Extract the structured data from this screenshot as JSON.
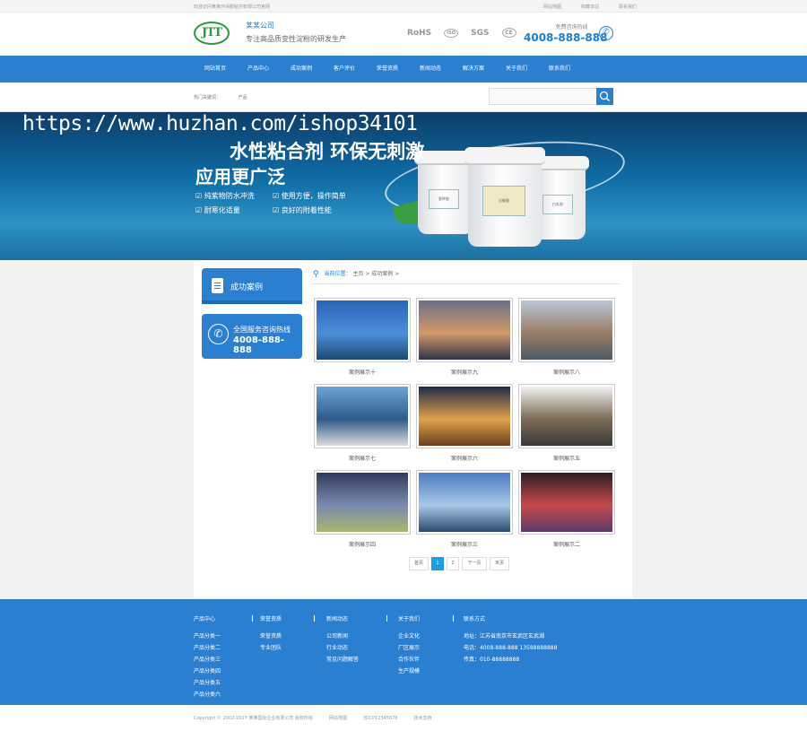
{
  "topbar": {
    "welcome": "欢迎访问某某环保胶粘剂有限公司官网",
    "links": [
      "网站地图",
      "收藏本站",
      "联系我们"
    ]
  },
  "header": {
    "logo_text": "JTT",
    "company_name": "某某公司",
    "slogan": "专注高品质变性淀粉的研发生产",
    "certs": [
      "RoHS",
      "ISO",
      "SGS",
      "CE"
    ],
    "hotline_label": "免费咨询热线",
    "hotline_number": "4008-888-888"
  },
  "nav": {
    "items": [
      "网站首页",
      "产品中心",
      "成功案例",
      "客户评价",
      "荣誉资质",
      "新闻动态",
      "解决方案",
      "关于我们",
      "联系我们"
    ]
  },
  "search": {
    "hot_label": "热门关键词：",
    "hot_keyword": "产品",
    "placeholder": ""
  },
  "banner": {
    "watermark": "https://www.huzhan.com/ishop34101",
    "headline": "水性粘合剂  环保无刺激",
    "subheadline": "应用更广泛",
    "features": [
      "纯紫物防水冲洗",
      "使用方便，操作简单",
      "耐寒化适量",
      "良好的附着性能"
    ],
    "bucket_labels": [
      "瓷砖胶",
      "压敏胶",
      "白乳胶"
    ]
  },
  "sidebar": {
    "title": "成功案例",
    "contact_label": "全国服务咨询热线",
    "contact_number": "4008-888-888"
  },
  "breadcrumb": {
    "prefix": "当前位置：",
    "path": "主页 > 成功案例 >"
  },
  "cases": [
    {
      "caption": "案例展示十",
      "colors": [
        "#2a63b8",
        "#4c8fd9",
        "#1e4a70"
      ]
    },
    {
      "caption": "案例展示九",
      "colors": [
        "#6a6f86",
        "#d29a6a",
        "#2e3347"
      ]
    },
    {
      "caption": "案例展示八",
      "colors": [
        "#b9c7d8",
        "#9a7d66",
        "#4d5a66"
      ]
    },
    {
      "caption": "案例展示七",
      "colors": [
        "#6fa3d6",
        "#2f5a88",
        "#ddd"
      ]
    },
    {
      "caption": "案例展示六",
      "colors": [
        "#1f2a44",
        "#e0a24d",
        "#6b3f1c"
      ]
    },
    {
      "caption": "案例展示五",
      "colors": [
        "#f2f2f2",
        "#7b6a55",
        "#3a3a3a"
      ]
    },
    {
      "caption": "案例展示四",
      "colors": [
        "#303b5c",
        "#7a8ab0",
        "#a9b66c"
      ]
    },
    {
      "caption": "案例展示三",
      "colors": [
        "#4b7bc2",
        "#a9c8e6",
        "#2c4a6d"
      ]
    },
    {
      "caption": "案例展示二",
      "colors": [
        "#2b1d24",
        "#c74a4a",
        "#5a3a6b"
      ]
    }
  ],
  "pager": {
    "items": [
      "首页",
      "1",
      "2",
      "下一页",
      "末页"
    ],
    "active": "1"
  },
  "footer": {
    "columns": [
      {
        "title": "产品中心",
        "items": [
          "产品分类一",
          "产品分类二",
          "产品分类三",
          "产品分类四",
          "产品分类五",
          "产品分类六"
        ]
      },
      {
        "title": "荣誉资质",
        "items": [
          "荣誉资质",
          "专业团队"
        ]
      },
      {
        "title": "新闻动态",
        "items": [
          "公司新闻",
          "行业动态",
          "常见问题解答"
        ]
      },
      {
        "title": "关于我们",
        "items": [
          "企业文化",
          "厂区展示",
          "合作伙伴",
          "生产规模"
        ]
      },
      {
        "title": "联系方式",
        "items": [
          "地址：江苏省南京市玄武区玄武湖",
          "电话：4008-888-888 13588888888",
          "传真：010-88888888"
        ]
      }
    ]
  },
  "copyright": {
    "text": "Copyright © 2002-2017 某某国际企业有限公司 版权所有",
    "links": [
      "网站地图",
      "苏ICP12345678",
      "技术支持"
    ]
  }
}
